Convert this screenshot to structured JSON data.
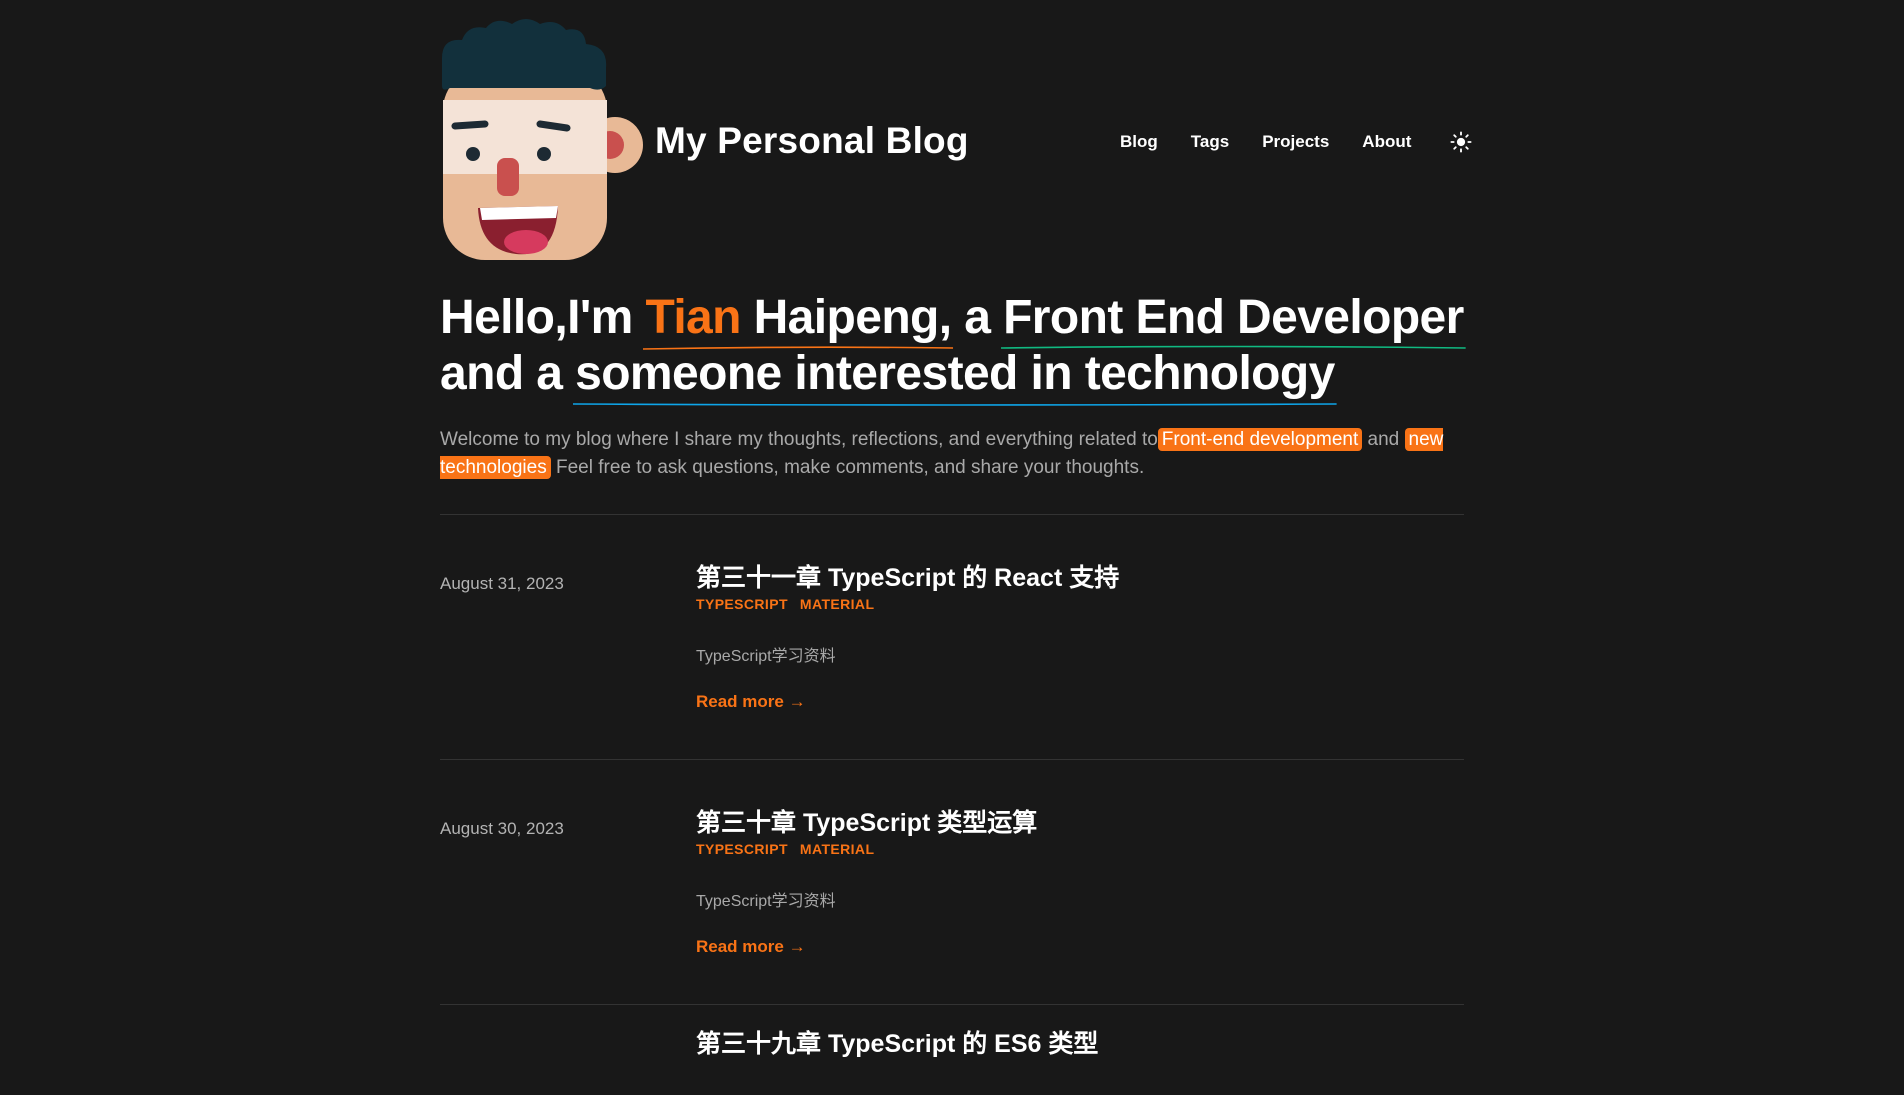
{
  "header": {
    "site_title": "My Personal Blog",
    "nav": [
      {
        "label": "Blog"
      },
      {
        "label": "Tags"
      },
      {
        "label": "Projects"
      },
      {
        "label": "About"
      }
    ],
    "theme_icon": "sun-icon"
  },
  "hero": {
    "line1_a": "Hello,I'm ",
    "line1_name_first": "Tian",
    "line1_name_rest": " Haipeng,",
    "line1_b": " a ",
    "line1_role": "Front End Developer",
    "line2_a": "and a ",
    "line2_interest": "someone interested in technology",
    "desc_a": "Welcome to my blog where I share my thoughts, reflections, and everything related to",
    "desc_hl1": "Front-end development",
    "desc_b": " and ",
    "desc_hl2": "new technologies",
    "desc_c": " Feel free to ask questions, make comments, and share your thoughts."
  },
  "colors": {
    "accent": "#f97316",
    "underline_green": "#10b981",
    "underline_blue": "#0ea5e9",
    "background": "#181818"
  },
  "posts": [
    {
      "date": "August 31, 2023",
      "title": "第三十一章 TypeScript 的 React 支持",
      "tags": [
        "TYPESCRIPT",
        "MATERIAL"
      ],
      "summary": "TypeScript学习资料",
      "read_more": "Read more →"
    },
    {
      "date": "August 30, 2023",
      "title": "第三十章 TypeScript 类型运算",
      "tags": [
        "TYPESCRIPT",
        "MATERIAL"
      ],
      "summary": "TypeScript学习资料",
      "read_more": "Read more →"
    },
    {
      "title": "第三十九章 TypeScript 的 ES6 类型"
    }
  ]
}
